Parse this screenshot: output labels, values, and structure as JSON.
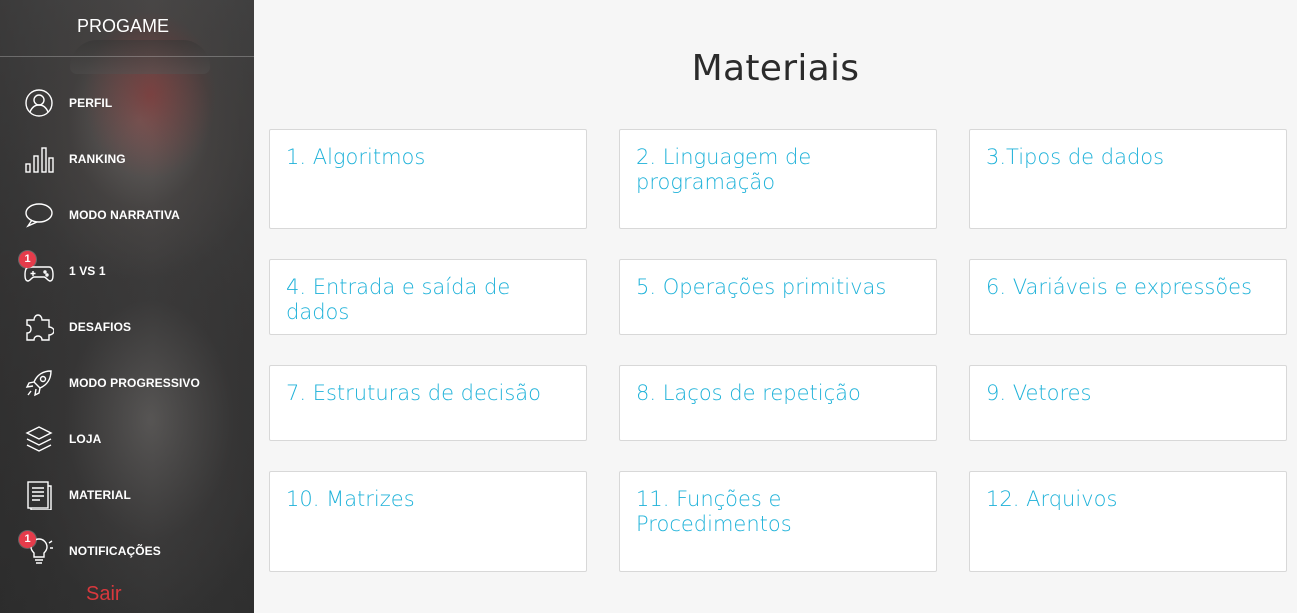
{
  "sidebar": {
    "brand": "PROGAME",
    "items": [
      {
        "label": "PERFIL",
        "icon": "user-icon"
      },
      {
        "label": "RANKING",
        "icon": "bar-chart-icon"
      },
      {
        "label": "MODO NARRATIVA",
        "icon": "speech-bubble-icon"
      },
      {
        "label": "1 VS 1",
        "icon": "gamepad-icon",
        "badge": "1"
      },
      {
        "label": "DESAFIOS",
        "icon": "puzzle-icon"
      },
      {
        "label": "MODO PROGRESSIVO",
        "icon": "rocket-icon"
      },
      {
        "label": "LOJA",
        "icon": "layers-icon"
      },
      {
        "label": "MATERIAL",
        "icon": "document-icon"
      },
      {
        "label": "NOTIFICAÇÕES",
        "icon": "lightbulb-icon",
        "badge": "1"
      }
    ],
    "logout": "Sair",
    "colors": {
      "badge": "#e53c4b",
      "logout": "#d9383d"
    }
  },
  "main": {
    "title": "Materiais",
    "cards": [
      "1. Algoritmos",
      "2. Linguagem de programação",
      "3.Tipos de dados",
      "4. Entrada e saída de dados",
      "5. Operações primitivas",
      "6. Variáveis e expressões",
      "7. Estruturas de decisão",
      "8. Laços de repetição",
      "9. Vetores",
      "10. Matrizes",
      "11. Funções e Procedimentos",
      "12. Arquivos"
    ],
    "colors": {
      "card_text": "#1fb2d9",
      "background": "#f6f6f6"
    }
  }
}
